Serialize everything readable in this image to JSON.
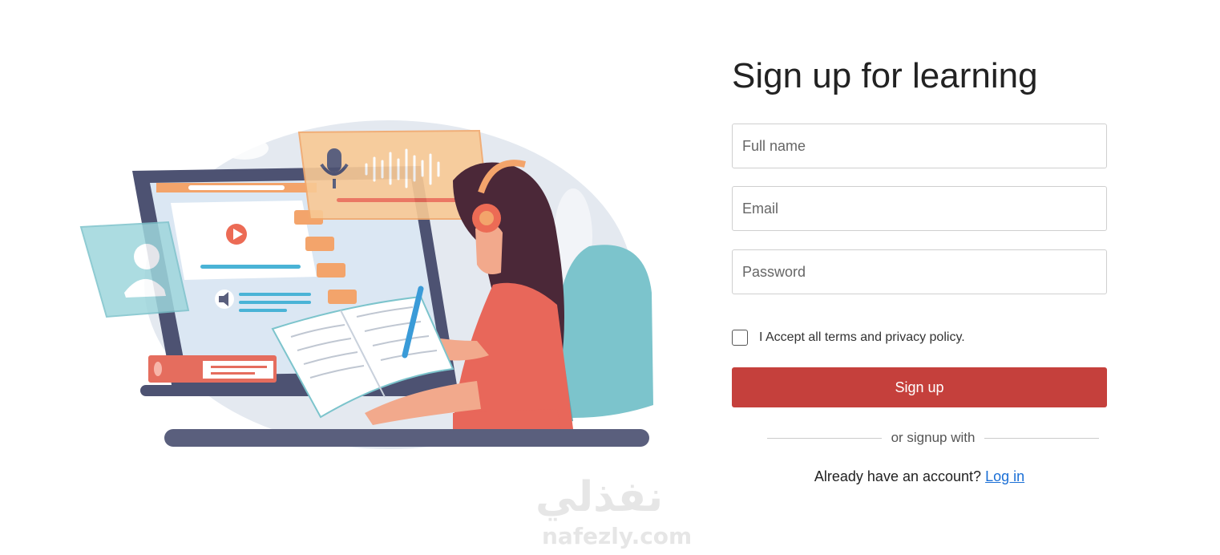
{
  "form": {
    "title": "Sign up for learning",
    "fields": {
      "full_name_placeholder": "Full name",
      "email_placeholder": "Email",
      "password_placeholder": "Password"
    },
    "terms_label": "I Accept all terms and privacy policy.",
    "terms_checked": false,
    "signup_button": "Sign up",
    "divider_text": "or signup with",
    "login_prompt": "Already have an account?",
    "login_link": "Log in"
  },
  "watermark": {
    "arabic": "نفذلي",
    "latin": "nafezly.com"
  },
  "colors": {
    "primary_button": "#c5403c",
    "link": "#1a6fd6",
    "border": "#cfcfcf"
  },
  "icons": {
    "illustration": "student-online-learning-illustration",
    "microphone": "microphone-icon",
    "play": "play-icon",
    "speaker": "speaker-icon",
    "user": "user-avatar-icon"
  }
}
